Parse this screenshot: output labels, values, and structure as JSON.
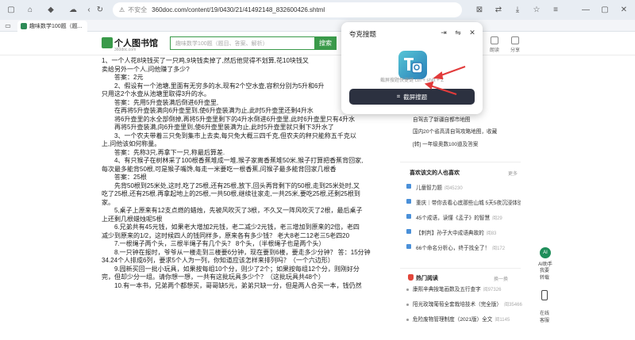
{
  "browser": {
    "url_prefix": "不安全",
    "url": "360doc.com/content/19/0430/21/41492148_832600426.shtml",
    "tab_title": "趣味数学100题（题..."
  },
  "site": {
    "logo_text": "个人图书馆",
    "logo_sub": "360doc.com",
    "search_placeholder": "趣味数学100题（题目、答案、解析）",
    "search_button": "搜索",
    "tools": [
      {
        "label": "朗读"
      },
      {
        "label": "分享"
      }
    ]
  },
  "article": {
    "lines": [
      "1、一个人花8块钱买了一只鸡,9块钱卖掉了,然后他觉得不划算,花10块钱又",
      "卖给另外一个人,问他赚了多少?",
      "　　答案：2元",
      "　　2、假设有一个池塘,里面有无穷多的水,现有2个空水壶,容积分别为5升和6升",
      "只用这2个水壶从池塘里取得3升的水。",
      "　　答案：先用5升壶装满后倒进6升壶里,",
      "　　在再将5升壶装满向6升壶里到,使6升壶装满为止,此时5升壶里还剩4升水",
      "　　将6升壶里的水全部倒掉,再将5升壶里剩下的4升水倒进6升壶里,此时6升壶里只有4升水",
      "　　再将5升壶装满,向6升壶里到,使6升壶里装满为止,此时5升壶里就只剩下3升水了",
      "　　3、一个农夫带着三只免到集市上去卖,每只免大概三四千克,但农夫的秤只能称五千克以",
      "上,问他该如何称量。",
      "　　答案：先称3只,再拿下一只,称最后算差.",
      "　　4、有只猴子在树林采了100根香蕉堆成一堆,猴子家离香蕉堆50米,猴子打算把香蕉背回家,",
      "每次最多能背50根,可是猴子嘴馋,每走一米要吃一根香蕉,问猴子最多能背回家几根香",
      "　　答案：25根",
      "　　先背50根到25米处,这时,吃了25根,还有25根,放下,回头再背剩下的50根,走到25米处时,又",
      "吃了25根,还有25根.再拿起地上的25根,一共50根,继续往家走,一共25米,要吃25根,还剩25根到",
      "家。",
      "　　5,桌子上原来有12支点燃的蜡烛，先被风吹灭了3根，不久又一阵风吹灭了2根，最后桌子",
      "上还剩几根蜡烛呢5根",
      "　　6.兄弟共有45元钱，如果老大增加2元钱，老二减少2元钱，老三增加到原来的2倍，老四",
      "减少到原来的1/2，这时候四人的钱同样多，原来各有多少钱？ 老大8老二12老三5老四20",
      "　　7.一根绳子两个头，三根半绳子有几个头？ 8个头，（半根绳子也是两个头）",
      "　　8.一只钟在报时，爷爷从一楼走到三楼要6分钟，现在要到6楼，要走多少分钟？ 答：15分钟",
      "34.24个人排成6列，要求5个人为一列，你知道应该怎样来排列吗？（一个六边形）",
      "　　9.园新买回一批小玩具，如果按每组10个分，则少了2个；如果按每组12个分，则刚好分",
      "完，但却少分一组。请你想一想，一共有这批玩具多少个？（这批玩具共48个）",
      "　　10.有一本书，兄弟两个都想买，哥哥缺5元，弟弟只缺一分，但是两人合买一本，钱仍然"
    ]
  },
  "sidebar": {
    "partial_items": [
      "...旦狂欢,感",
      "自驾去了新疆自都市地图",
      "国内20个省高清自驾攻略地图，收藏",
      "[转] 一年级奥数100道及答案"
    ],
    "hot_title": "喜欢该文的人也喜欢",
    "hot_more": "更多",
    "hot_items": [
      {
        "text": "儿童智力题",
        "meta": "阅45230",
        "icon": "doc-icon"
      },
      {
        "text": "重庆｜带你去看心底那些山城 5天5夜沉浸体验（美食/民宿/人文/美食）",
        "meta": "阅28",
        "icon": "pin-icon"
      },
      {
        "text": "45个成语，读懂《孟子》的智慧",
        "meta": "阅29",
        "icon": "pin-icon"
      },
      {
        "text": "【刺判】孙子大中成语典故的",
        "meta": "阅83",
        "icon": "pin-icon"
      },
      {
        "text": "66个命名分析心，终于找全了！",
        "meta": "阅172",
        "icon": "pin-icon"
      }
    ],
    "read_title": "热门阅读",
    "read_more": "换一换",
    "read_items": [
      {
        "text": "康熙辛典按笔画数及五行查字",
        "meta": "阅97326"
      },
      {
        "text": "阳光玫瑰葡萄全套栽培技术（完全版）",
        "meta": "阅35466"
      },
      {
        "text": "危险废物管理制度（2021版）全文",
        "meta": "阅1145"
      }
    ]
  },
  "float": {
    "ai_label": "AI助手",
    "ai_icon_text": "AI",
    "transfer": "我要\n转载",
    "phone": "",
    "feedback": "在线\n客服"
  },
  "popup": {
    "title": "夸克搜题",
    "hint": "截屏搜题快捷键 ctrl + shift + Z",
    "button": "截屏搜题"
  },
  "colors": {
    "brand_green": "#3a9a4a",
    "popup_button": "#2c3140",
    "arrow_red": "#e23b3b"
  }
}
